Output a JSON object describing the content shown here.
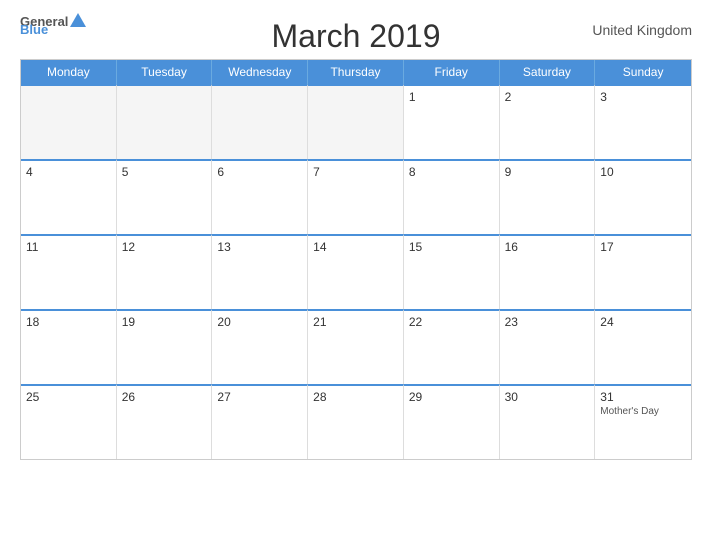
{
  "logo": {
    "general": "General",
    "blue": "Blue"
  },
  "header": {
    "title": "March 2019",
    "region": "United Kingdom"
  },
  "days": {
    "headers": [
      "Monday",
      "Tuesday",
      "Wednesday",
      "Thursday",
      "Friday",
      "Saturday",
      "Sunday"
    ]
  },
  "weeks": [
    [
      {
        "number": "",
        "empty": true
      },
      {
        "number": "",
        "empty": true
      },
      {
        "number": "",
        "empty": true
      },
      {
        "number": "",
        "empty": true
      },
      {
        "number": "1",
        "empty": false,
        "event": ""
      },
      {
        "number": "2",
        "empty": false,
        "event": ""
      },
      {
        "number": "3",
        "empty": false,
        "event": ""
      }
    ],
    [
      {
        "number": "4",
        "empty": false,
        "event": ""
      },
      {
        "number": "5",
        "empty": false,
        "event": ""
      },
      {
        "number": "6",
        "empty": false,
        "event": ""
      },
      {
        "number": "7",
        "empty": false,
        "event": ""
      },
      {
        "number": "8",
        "empty": false,
        "event": ""
      },
      {
        "number": "9",
        "empty": false,
        "event": ""
      },
      {
        "number": "10",
        "empty": false,
        "event": ""
      }
    ],
    [
      {
        "number": "11",
        "empty": false,
        "event": ""
      },
      {
        "number": "12",
        "empty": false,
        "event": ""
      },
      {
        "number": "13",
        "empty": false,
        "event": ""
      },
      {
        "number": "14",
        "empty": false,
        "event": ""
      },
      {
        "number": "15",
        "empty": false,
        "event": ""
      },
      {
        "number": "16",
        "empty": false,
        "event": ""
      },
      {
        "number": "17",
        "empty": false,
        "event": ""
      }
    ],
    [
      {
        "number": "18",
        "empty": false,
        "event": ""
      },
      {
        "number": "19",
        "empty": false,
        "event": ""
      },
      {
        "number": "20",
        "empty": false,
        "event": ""
      },
      {
        "number": "21",
        "empty": false,
        "event": ""
      },
      {
        "number": "22",
        "empty": false,
        "event": ""
      },
      {
        "number": "23",
        "empty": false,
        "event": ""
      },
      {
        "number": "24",
        "empty": false,
        "event": ""
      }
    ],
    [
      {
        "number": "25",
        "empty": false,
        "event": ""
      },
      {
        "number": "26",
        "empty": false,
        "event": ""
      },
      {
        "number": "27",
        "empty": false,
        "event": ""
      },
      {
        "number": "28",
        "empty": false,
        "event": ""
      },
      {
        "number": "29",
        "empty": false,
        "event": ""
      },
      {
        "number": "30",
        "empty": false,
        "event": ""
      },
      {
        "number": "31",
        "empty": false,
        "event": "Mother's Day"
      }
    ]
  ]
}
